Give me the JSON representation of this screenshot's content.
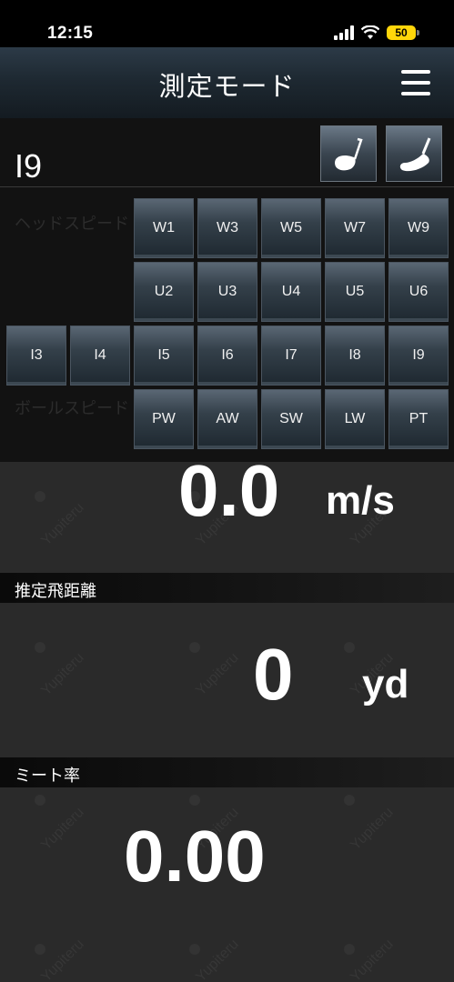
{
  "status_bar": {
    "time": "12:15",
    "battery": "50",
    "icons": [
      "signal-icon",
      "wifi-icon",
      "battery-icon"
    ]
  },
  "header": {
    "title": "測定モード",
    "menu_icon": "hamburger-menu-icon"
  },
  "current_club": "I9",
  "club_type_buttons": [
    {
      "name": "driver-head-icon"
    },
    {
      "name": "iron-head-icon"
    }
  ],
  "hidden_labels": {
    "head_speed": "ヘッドスピード",
    "ball_speed": "ボールスピード"
  },
  "club_grid": {
    "row1": [
      "W1",
      "W3",
      "W5",
      "W7",
      "W9"
    ],
    "row2": [
      "U2",
      "U3",
      "U4",
      "U5",
      "U6"
    ],
    "row3": [
      "I3",
      "I4",
      "I5",
      "I6",
      "I7",
      "I8",
      "I9"
    ],
    "row4": [
      "PW",
      "AW",
      "SW",
      "LW",
      "PT"
    ]
  },
  "speed": {
    "value": "0.0",
    "unit": "m/s"
  },
  "distance": {
    "label": "推定飛距離",
    "value": "0",
    "unit": "yd"
  },
  "meet": {
    "label": "ミート率",
    "value": "0.00"
  },
  "watermark": "Yupiteru"
}
